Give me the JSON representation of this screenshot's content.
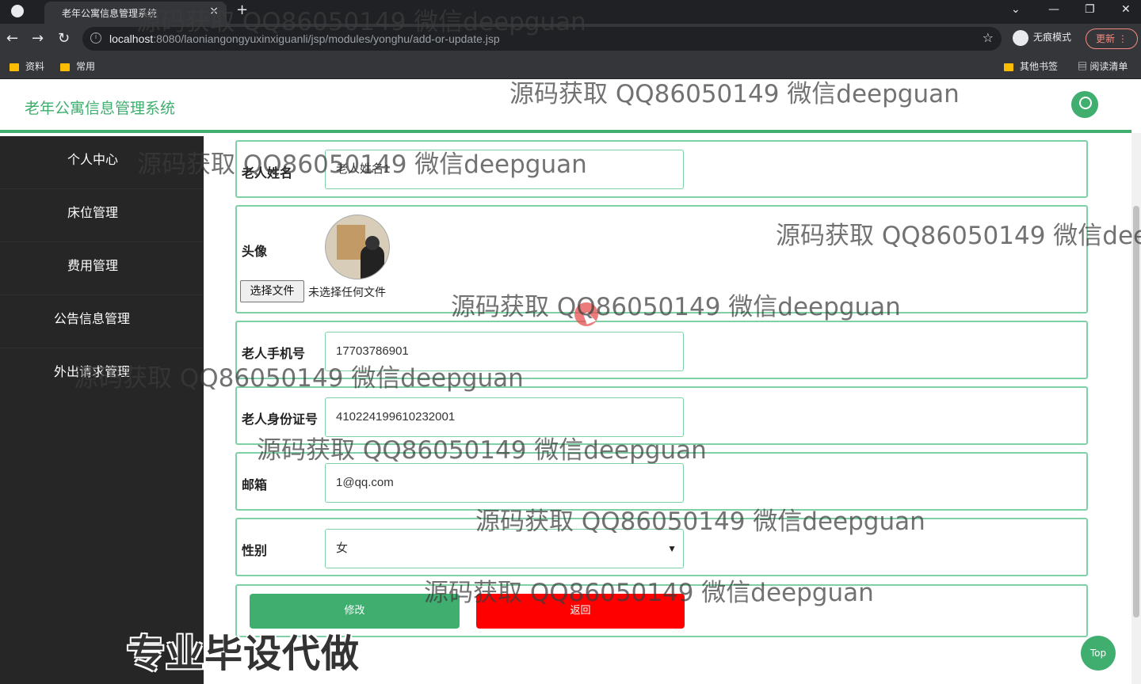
{
  "browser": {
    "tab_title": "老年公寓信息管理系统",
    "url_host": "localhost",
    "url_rest": ":8080/laoniangongyuxinxiguanli/jsp/modules/yonghu/add-or-update.jsp",
    "incognito_label": "无痕模式",
    "update_label": "更新",
    "bookmarks": [
      "资料",
      "常用"
    ],
    "other_bookmarks": "其他书签",
    "reading_list": "阅读清单"
  },
  "header": {
    "title": "老年公寓信息管理系统"
  },
  "sidebar": {
    "items": [
      {
        "label": "个人中心"
      },
      {
        "label": "床位管理"
      },
      {
        "label": "费用管理"
      },
      {
        "label": "公告信息管理"
      },
      {
        "label": "外出请求管理"
      }
    ]
  },
  "form": {
    "name_label": "老人姓名",
    "name_value": "老人姓名1",
    "avatar_label": "头像",
    "file_button": "选择文件",
    "file_status": "未选择任何文件",
    "phone_label": "老人手机号",
    "phone_value": "17703786901",
    "idcard_label": "老人身份证号",
    "idcard_value": "410224199610232001",
    "email_label": "邮箱",
    "email_value": "1@qq.com",
    "gender_label": "性别",
    "gender_value": "女",
    "edit_button": "修改",
    "back_button": "返回"
  },
  "top_button": "Top",
  "watermark": "源码获取 QQ86050149 微信deepguan",
  "overlay_text": "专业毕设代做",
  "colors": {
    "accent": "#3fae6f",
    "danger": "#ff0000",
    "sidebar_bg": "#262626"
  }
}
